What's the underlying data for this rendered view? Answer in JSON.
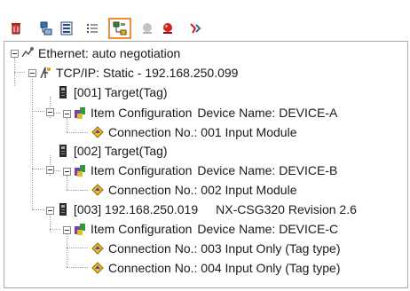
{
  "toolbar": {
    "buttons": [
      {
        "icon": "delete-icon"
      },
      {
        "icon": "tree-view-icon"
      },
      {
        "icon": "monitor-icon"
      },
      {
        "icon": "list-icon"
      },
      {
        "icon": "network-config-icon",
        "active": true
      },
      {
        "icon": "gray-indicator-icon"
      },
      {
        "icon": "red-indicator-icon"
      },
      {
        "icon": "pin-icon"
      }
    ],
    "active_border_color": "#f08c33"
  },
  "tree": {
    "ethernet": "Ethernet: auto negotiation",
    "tcpip": "TCP/IP: Static - 192.168.250.099",
    "targets": [
      {
        "label": "[001] Target(Tag)",
        "item_config": "Item Configuration",
        "device_name": "Device Name: DEVICE-A",
        "connections": [
          "Connection No.: 001  Input Module"
        ]
      },
      {
        "label": "[002] Target(Tag)",
        "item_config": "Item Configuration",
        "device_name": "Device Name: DEVICE-B",
        "connections": [
          "Connection No.: 002  Input Module"
        ]
      },
      {
        "label": "[003]  192.168.250.019",
        "label_extra": "NX-CSG320 Revision 2.6",
        "item_config": "Item Configuration",
        "device_name": "Device Name: DEVICE-C",
        "connections": [
          "Connection No.: 003 Input Only (Tag type)",
          "Connection No.: 004 Input Only (Tag type)"
        ]
      }
    ]
  }
}
